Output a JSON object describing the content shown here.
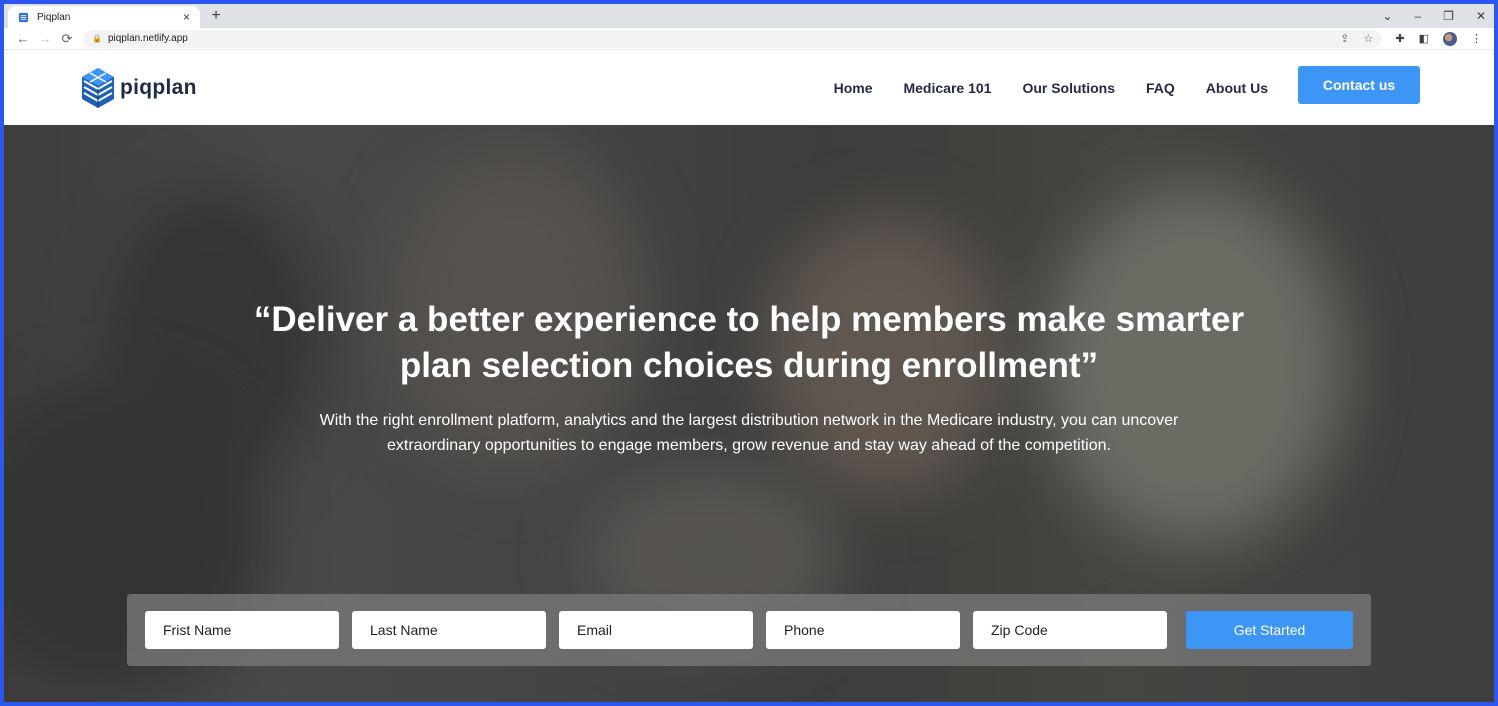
{
  "browser": {
    "tab_title": "Piqplan",
    "tab_close": "×",
    "new_tab": "+",
    "url": "piqplan.netlify.app",
    "window_controls": [
      "⌄",
      "–",
      "❐",
      "✕"
    ]
  },
  "header": {
    "logo_text": "piqplan",
    "nav": [
      "Home",
      "Medicare 101",
      "Our Solutions",
      "FAQ",
      "About Us"
    ],
    "contact_label": "Contact us"
  },
  "hero": {
    "headline_line1": "“Deliver a better experience to help members make smarter",
    "headline_line2": "plan selection choices during enrollment”",
    "subtext_line1": "With the right enrollment platform, analytics and the largest distribution network in the Medicare industry, you can uncover",
    "subtext_line2": "extraordinary opportunities to engage members, grow revenue and stay way ahead of the competition."
  },
  "form": {
    "first_name_placeholder": "Frist Name",
    "last_name_placeholder": "Last Name",
    "email_placeholder": "Email",
    "phone_placeholder": "Phone",
    "zip_placeholder": "Zip Code",
    "submit_label": "Get Started"
  },
  "colors": {
    "accent": "#3d95f5",
    "frame_border": "#2b56f0",
    "nav_text": "#1f2a44"
  }
}
